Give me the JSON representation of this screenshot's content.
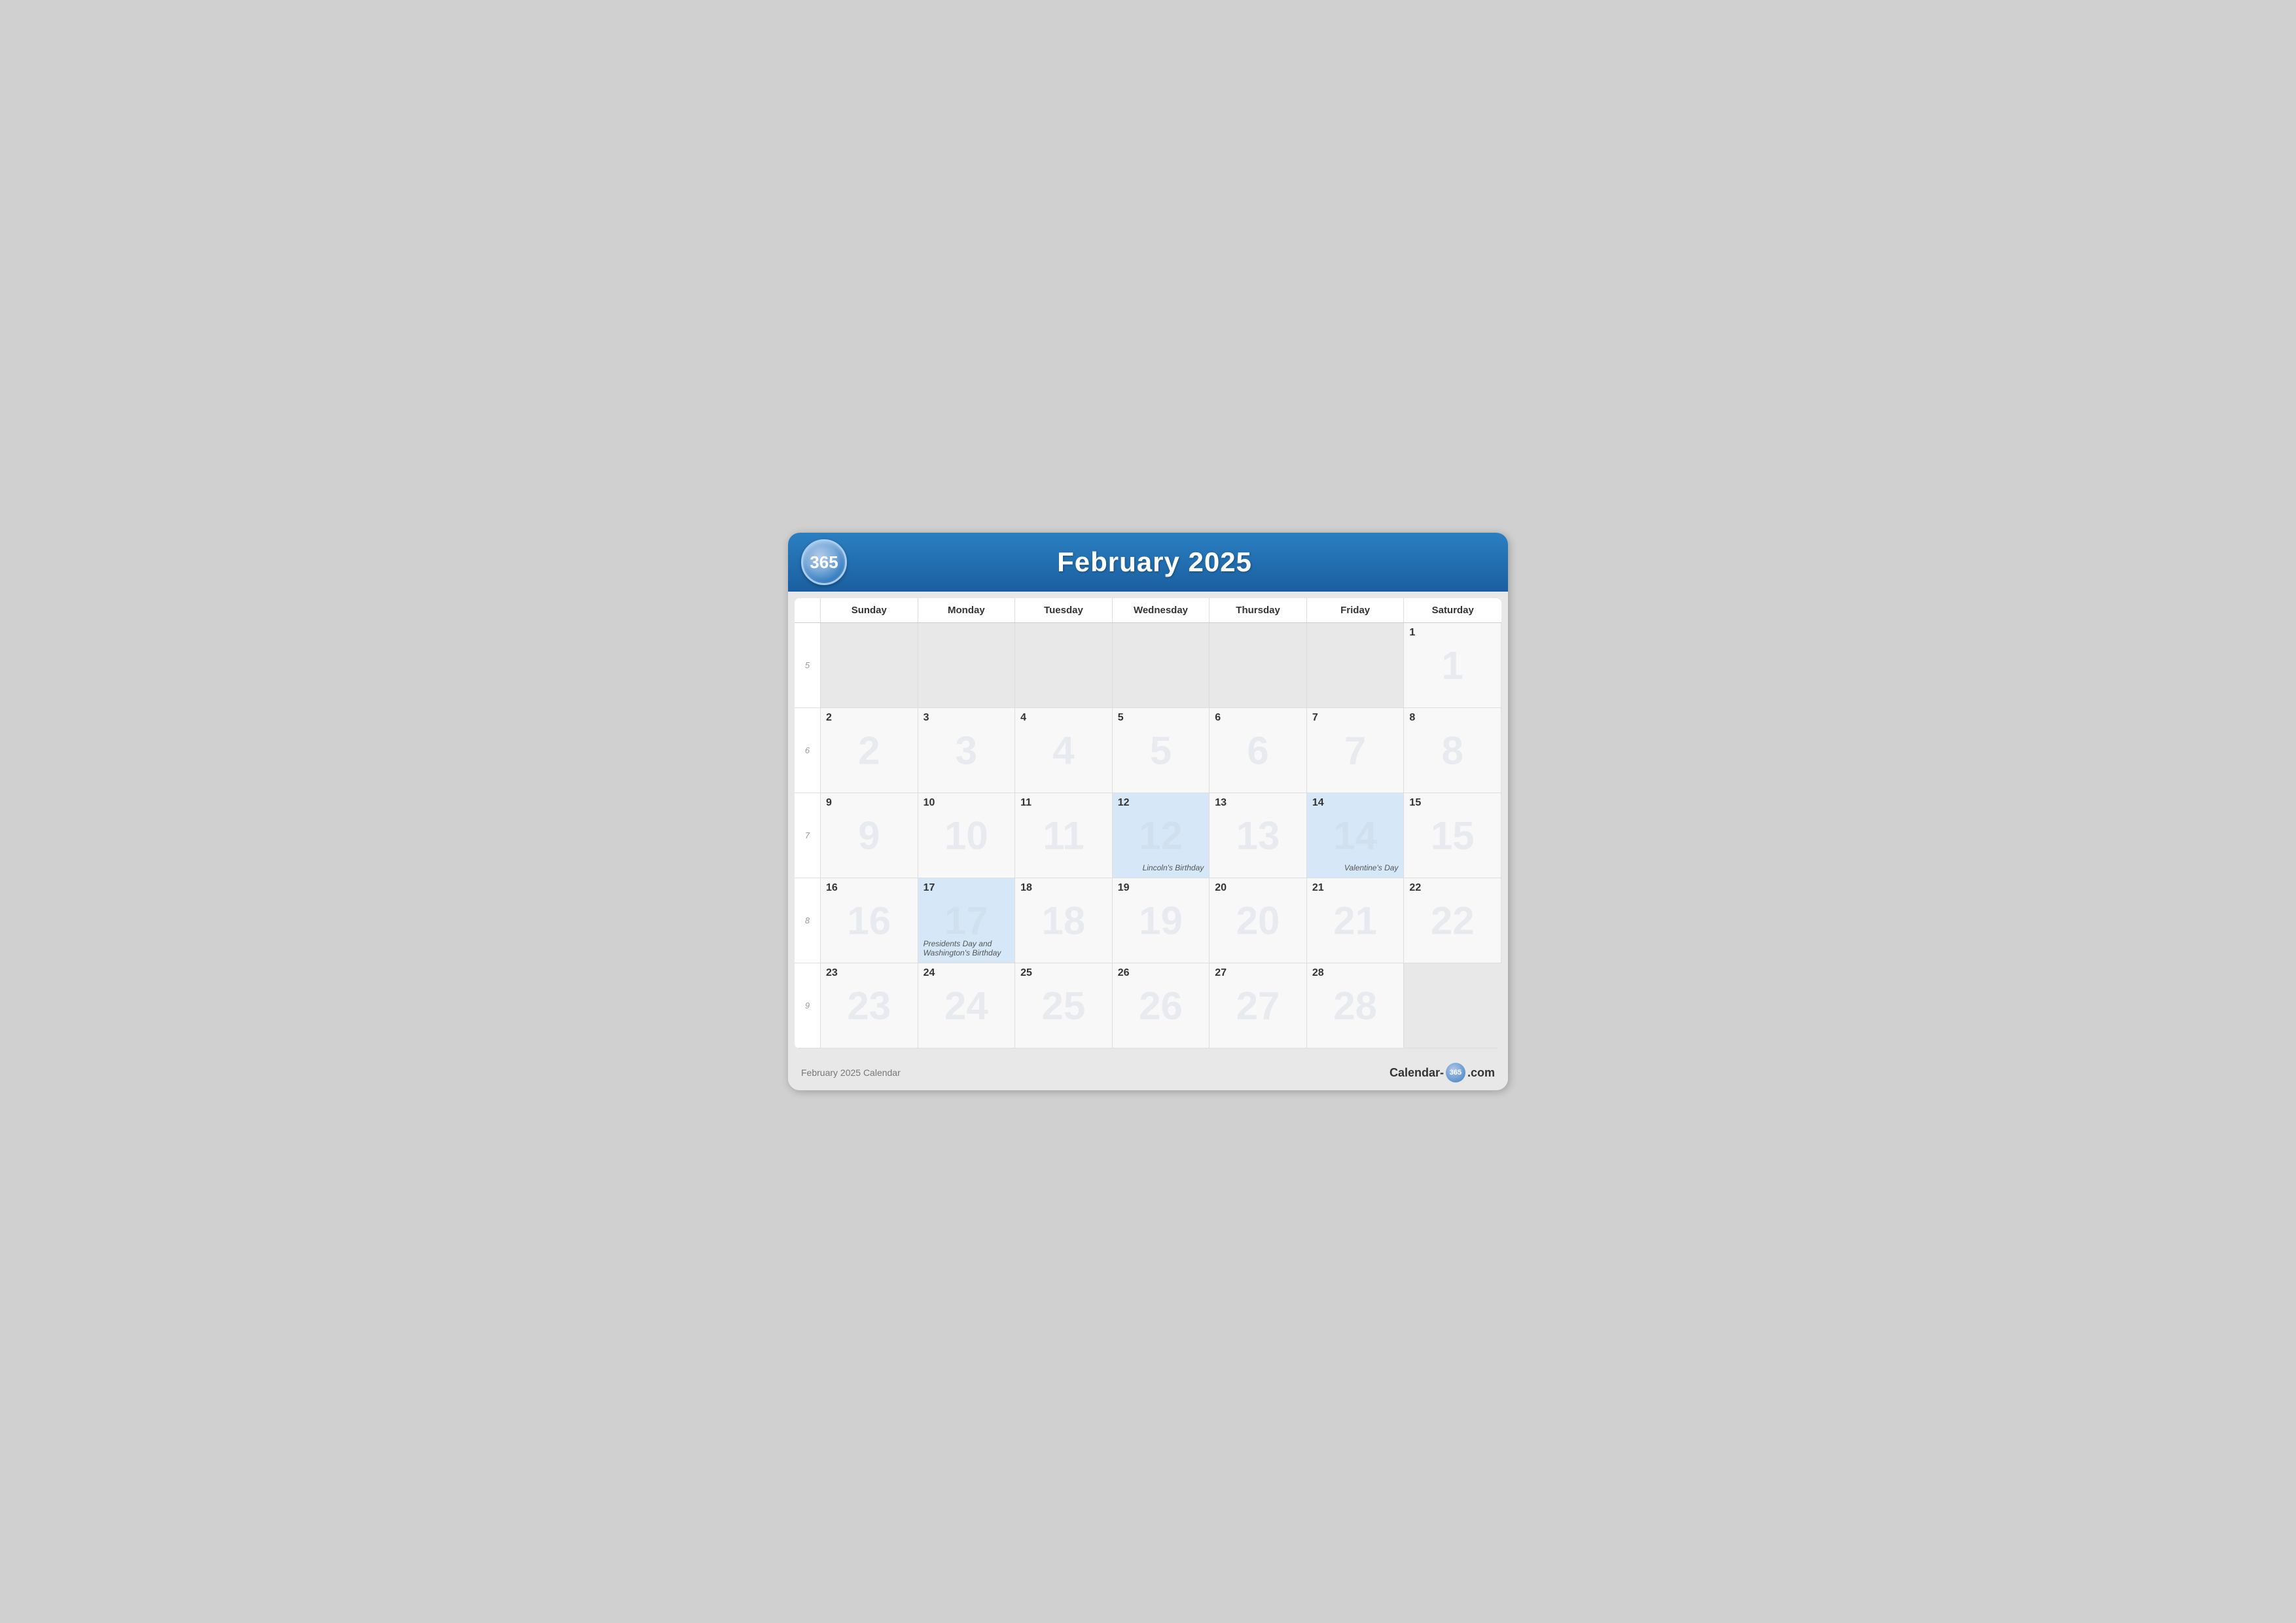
{
  "header": {
    "logo": "365",
    "title": "February 2025"
  },
  "day_headers": [
    "Sunday",
    "Monday",
    "Tuesday",
    "Wednesday",
    "Thursday",
    "Friday",
    "Saturday"
  ],
  "weeks": [
    {
      "week_num": "5",
      "days": [
        {
          "date": "",
          "type": "empty"
        },
        {
          "date": "",
          "type": "empty"
        },
        {
          "date": "",
          "type": "empty"
        },
        {
          "date": "",
          "type": "empty"
        },
        {
          "date": "",
          "type": "empty"
        },
        {
          "date": "",
          "type": "empty"
        },
        {
          "date": "1",
          "type": "active"
        }
      ]
    },
    {
      "week_num": "6",
      "days": [
        {
          "date": "2",
          "type": "active"
        },
        {
          "date": "3",
          "type": "active"
        },
        {
          "date": "4",
          "type": "active"
        },
        {
          "date": "5",
          "type": "active"
        },
        {
          "date": "6",
          "type": "active"
        },
        {
          "date": "7",
          "type": "active"
        },
        {
          "date": "8",
          "type": "active"
        }
      ]
    },
    {
      "week_num": "7",
      "days": [
        {
          "date": "9",
          "type": "active"
        },
        {
          "date": "10",
          "type": "active"
        },
        {
          "date": "11",
          "type": "active"
        },
        {
          "date": "12",
          "type": "highlighted",
          "event": "Lincoln's Birthday",
          "event_pos": "bottom-right"
        },
        {
          "date": "13",
          "type": "active"
        },
        {
          "date": "14",
          "type": "highlighted",
          "event": "Valentine's Day",
          "event_pos": "bottom-right"
        },
        {
          "date": "15",
          "type": "active"
        }
      ]
    },
    {
      "week_num": "8",
      "days": [
        {
          "date": "16",
          "type": "active"
        },
        {
          "date": "17",
          "type": "highlighted",
          "event": "Presidents Day and Washington's Birthday",
          "event_pos": "bottom-left"
        },
        {
          "date": "18",
          "type": "active"
        },
        {
          "date": "19",
          "type": "active"
        },
        {
          "date": "20",
          "type": "active"
        },
        {
          "date": "21",
          "type": "active"
        },
        {
          "date": "22",
          "type": "active"
        }
      ]
    },
    {
      "week_num": "9",
      "days": [
        {
          "date": "23",
          "type": "active"
        },
        {
          "date": "24",
          "type": "active"
        },
        {
          "date": "25",
          "type": "active"
        },
        {
          "date": "26",
          "type": "active"
        },
        {
          "date": "27",
          "type": "active"
        },
        {
          "date": "28",
          "type": "active"
        },
        {
          "date": "",
          "type": "empty"
        }
      ]
    }
  ],
  "footer": {
    "left": "February 2025 Calendar",
    "right_prefix": "Calendar-",
    "right_badge": "365",
    "right_suffix": ".com"
  }
}
